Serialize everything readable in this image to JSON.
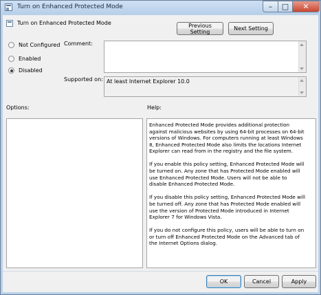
{
  "window": {
    "title": "Turn on Enhanced Protected Mode",
    "controls": {
      "minimize": "–",
      "maximize": "□",
      "close": "✕"
    }
  },
  "header": {
    "policy_title": "Turn on Enhanced Protected Mode",
    "prev_button": "Previous Setting",
    "next_button": "Next Setting"
  },
  "state_options": [
    {
      "label": "Not Configured",
      "checked": false
    },
    {
      "label": "Enabled",
      "checked": false
    },
    {
      "label": "Disabled",
      "checked": true
    }
  ],
  "comment": {
    "label": "Comment:",
    "value": ""
  },
  "supported": {
    "label": "Supported on:",
    "value": "At least Internet Explorer 10.0"
  },
  "options": {
    "label": "Options:"
  },
  "help": {
    "label": "Help:",
    "paragraphs": [
      "Enhanced Protected Mode provides additional protection against malicious websites by using 64-bit processes on 64-bit versions of Windows. For computers running at least Windows 8, Enhanced Protected Mode also limits the locations Internet Explorer can read from in the registry and the file system.",
      "If you enable this policy setting, Enhanced Protected Mode will be turned on. Any zone that has Protected Mode enabled will use Enhanced Protected Mode. Users will not be able to disable Enhanced Protected Mode.",
      "If you disable this policy setting, Enhanced Protected Mode will be turned off. Any zone that has Protected Mode enabled will use the version of Protected Mode introduced in Internet Explorer 7 for Windows Vista.",
      "If you do not configure this policy, users will be able to turn on or turn off Enhanced Protected Mode on the Advanced tab of the Internet Options dialog."
    ]
  },
  "footer": {
    "ok": "OK",
    "cancel": "Cancel",
    "apply": "Apply"
  }
}
